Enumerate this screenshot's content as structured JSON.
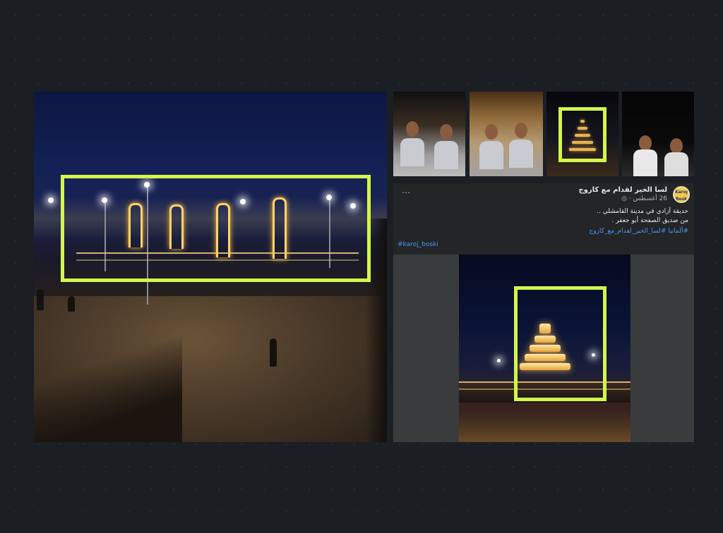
{
  "post": {
    "more_icon": "⋯",
    "page_name": "لسا الخير لقدام مع كاروج",
    "meta": "26 أغسطس · ",
    "avatar_text": "Karoj Bosk",
    "lines": [
      "حديقة آزادي في مدينة القامشلي ..",
      "من صديق الصفحة أبو جعفر ."
    ],
    "hashtags": "#ألمانيا #لسا_الخير_لقدام_مع_كاروج",
    "hashtag2": "#karoj_boski"
  },
  "icons": {
    "more": "more-horizontal-icon",
    "globe": "globe-icon",
    "avatar": "page-avatar-icon"
  },
  "colors": {
    "highlight": "#d4f54c",
    "background": "#1b1e22",
    "post_bg": "#242526",
    "link": "#4599ff"
  }
}
